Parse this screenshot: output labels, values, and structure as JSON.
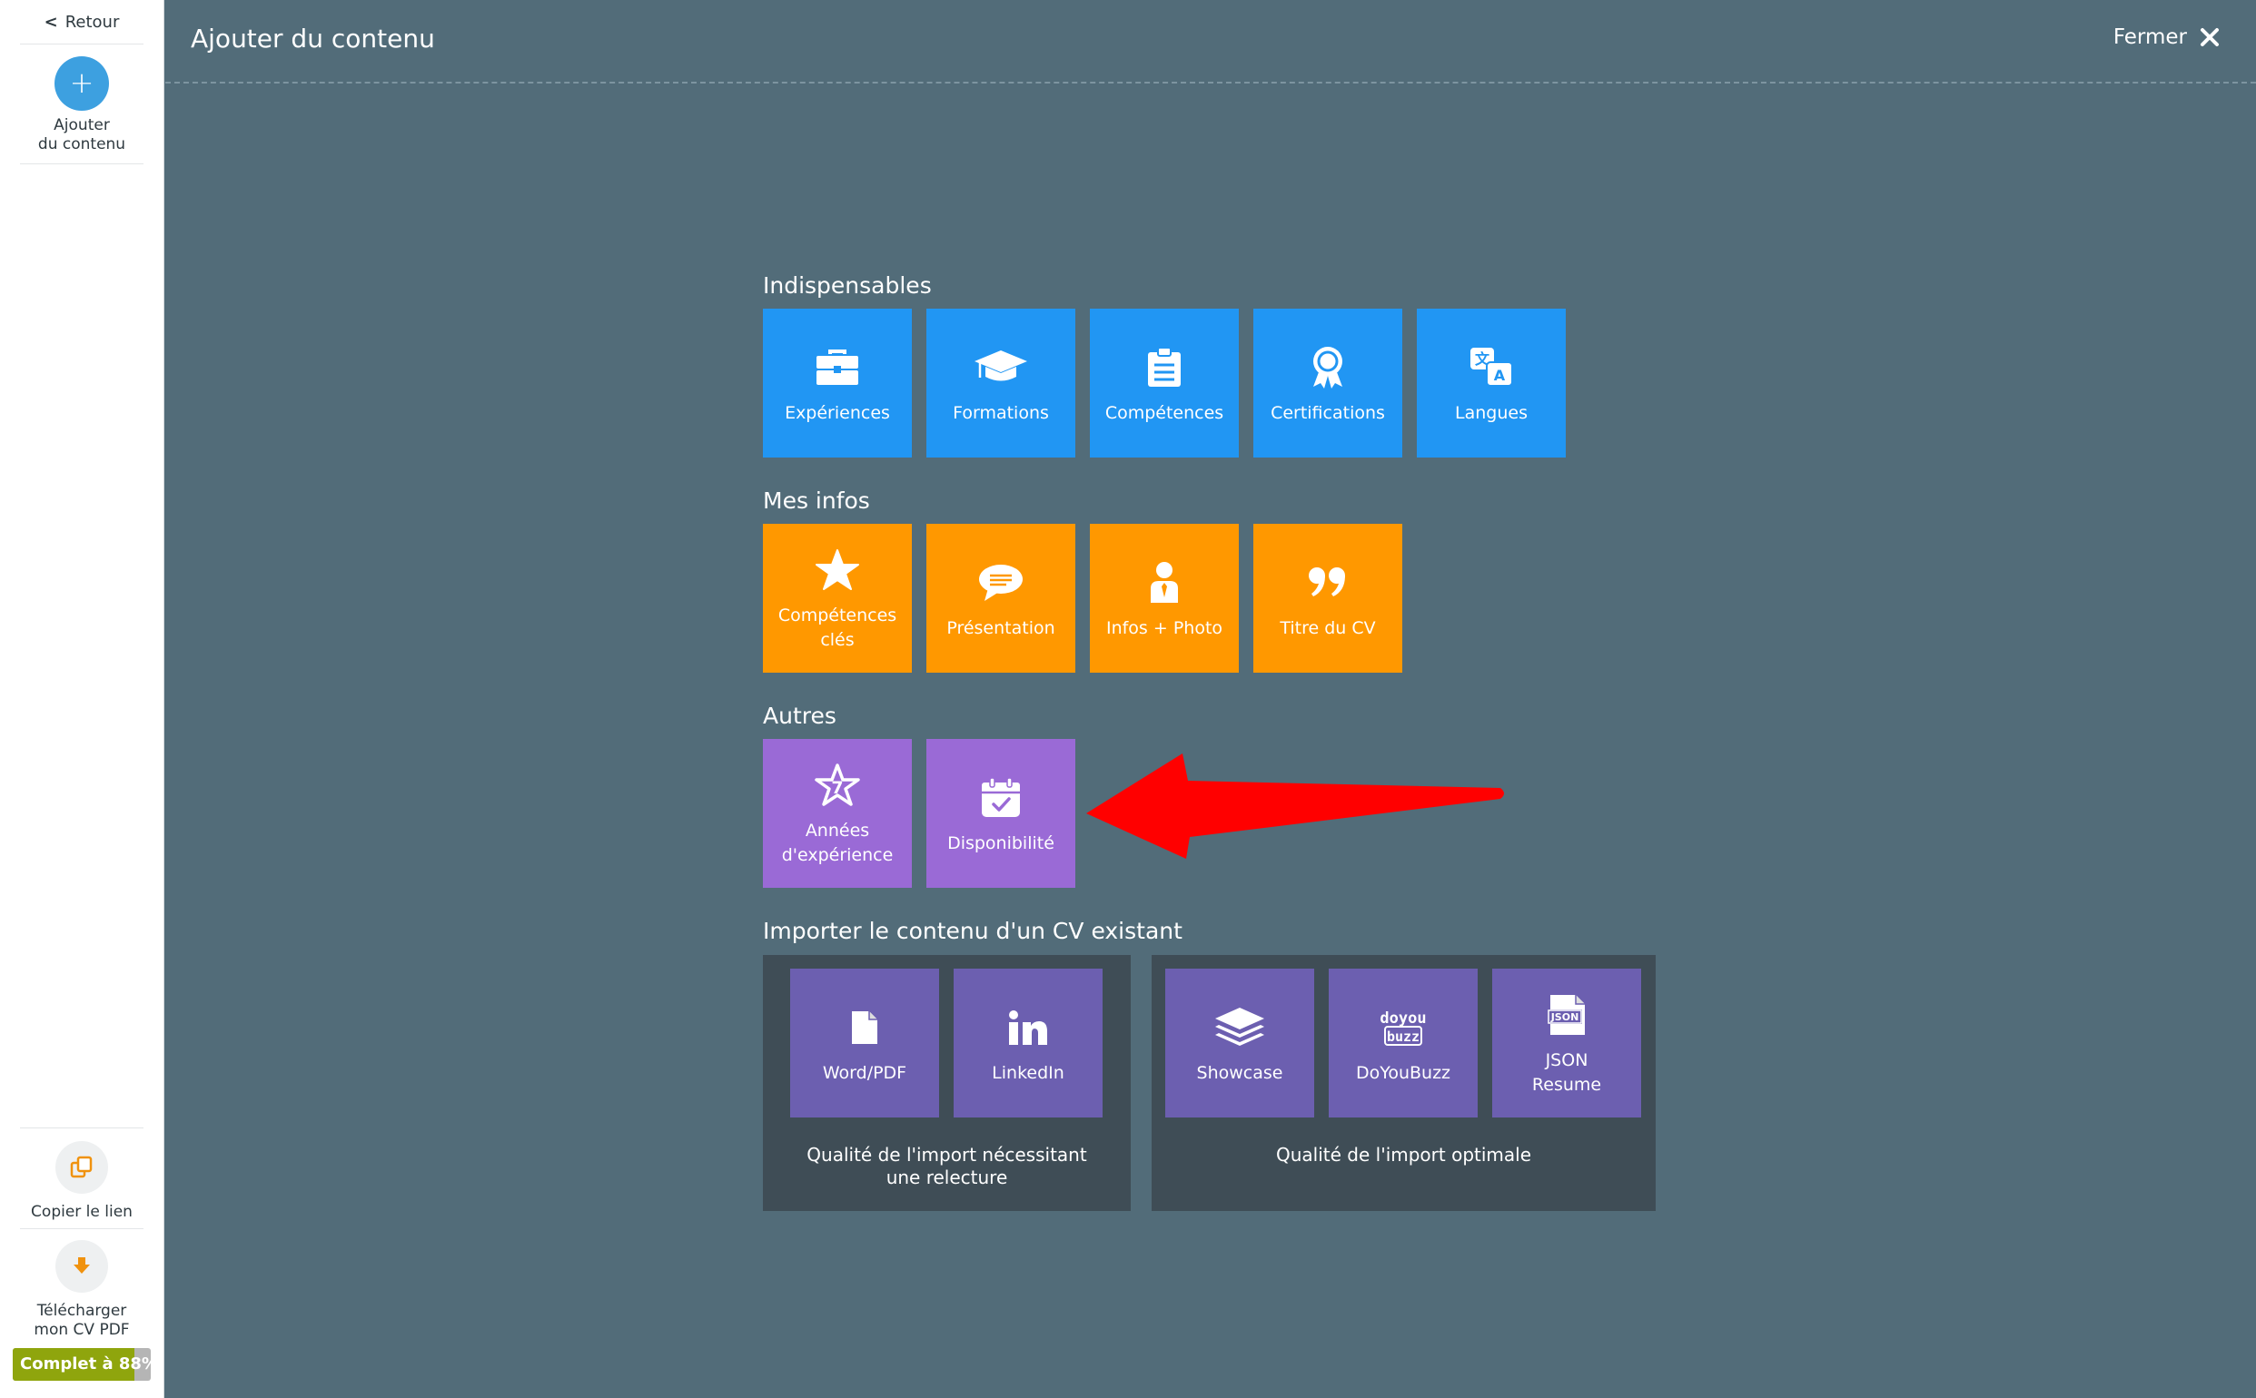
{
  "sidebar": {
    "back_label": "Retour",
    "add_content_line1": "Ajouter",
    "add_content_line2": "du contenu",
    "copy_link_label": "Copier le lien",
    "download_line1": "Télécharger",
    "download_line2": "mon CV PDF",
    "completion_label": "Complet à 88%",
    "completion_value": 0.88
  },
  "header": {
    "title": "Ajouter du contenu",
    "close_label": "Fermer"
  },
  "sections": {
    "essentials": {
      "title": "Indispensables",
      "tiles": [
        {
          "label": "Expériences",
          "icon": "briefcase-icon"
        },
        {
          "label": "Formations",
          "icon": "graduation-cap-icon"
        },
        {
          "label": "Compétences",
          "icon": "clipboard-icon"
        },
        {
          "label": "Certifications",
          "icon": "award-ribbon-icon"
        },
        {
          "label": "Langues",
          "icon": "translate-icon"
        }
      ]
    },
    "my_info": {
      "title": "Mes infos",
      "tiles": [
        {
          "label": "Compétences clés",
          "icon": "star-icon"
        },
        {
          "label": "Présentation",
          "icon": "speech-bubble-icon"
        },
        {
          "label": "Infos + Photo",
          "icon": "person-icon"
        },
        {
          "label": "Titre du CV",
          "icon": "quote-icon"
        }
      ]
    },
    "others": {
      "title": "Autres",
      "tiles": [
        {
          "label": "Années d'expérience",
          "icon": "star-seven-icon"
        },
        {
          "label": "Disponibilité",
          "icon": "calendar-check-icon"
        }
      ]
    },
    "import": {
      "title": "Importer le contenu d'un CV existant",
      "panels": [
        {
          "note": "Qualité de l'import nécessitant une relecture",
          "tiles": [
            {
              "label": "Word/PDF",
              "icon": "document-icon"
            },
            {
              "label": "LinkedIn",
              "icon": "linkedin-icon"
            }
          ]
        },
        {
          "note": "Qualité de l'import optimale",
          "tiles": [
            {
              "label": "Showcase",
              "icon": "layers-icon"
            },
            {
              "label": "DoYouBuzz",
              "icon": "doyoubuzz-logo-icon",
              "logo_text": "doyou buzz"
            },
            {
              "label": "JSON Resume",
              "icon": "json-file-icon",
              "logo_text": "JSON"
            }
          ]
        }
      ]
    }
  },
  "annotation": {
    "icon": "red-arrow-icon",
    "color": "#ff0000"
  },
  "colors": {
    "background": "#526c79",
    "blue_tile": "#2196f3",
    "orange_tile": "#ff9800",
    "purple_tile": "#9a6ad6",
    "import_tile": "#6c5fb0",
    "panel": "#3f4d56",
    "progress": "#8fa50d"
  }
}
